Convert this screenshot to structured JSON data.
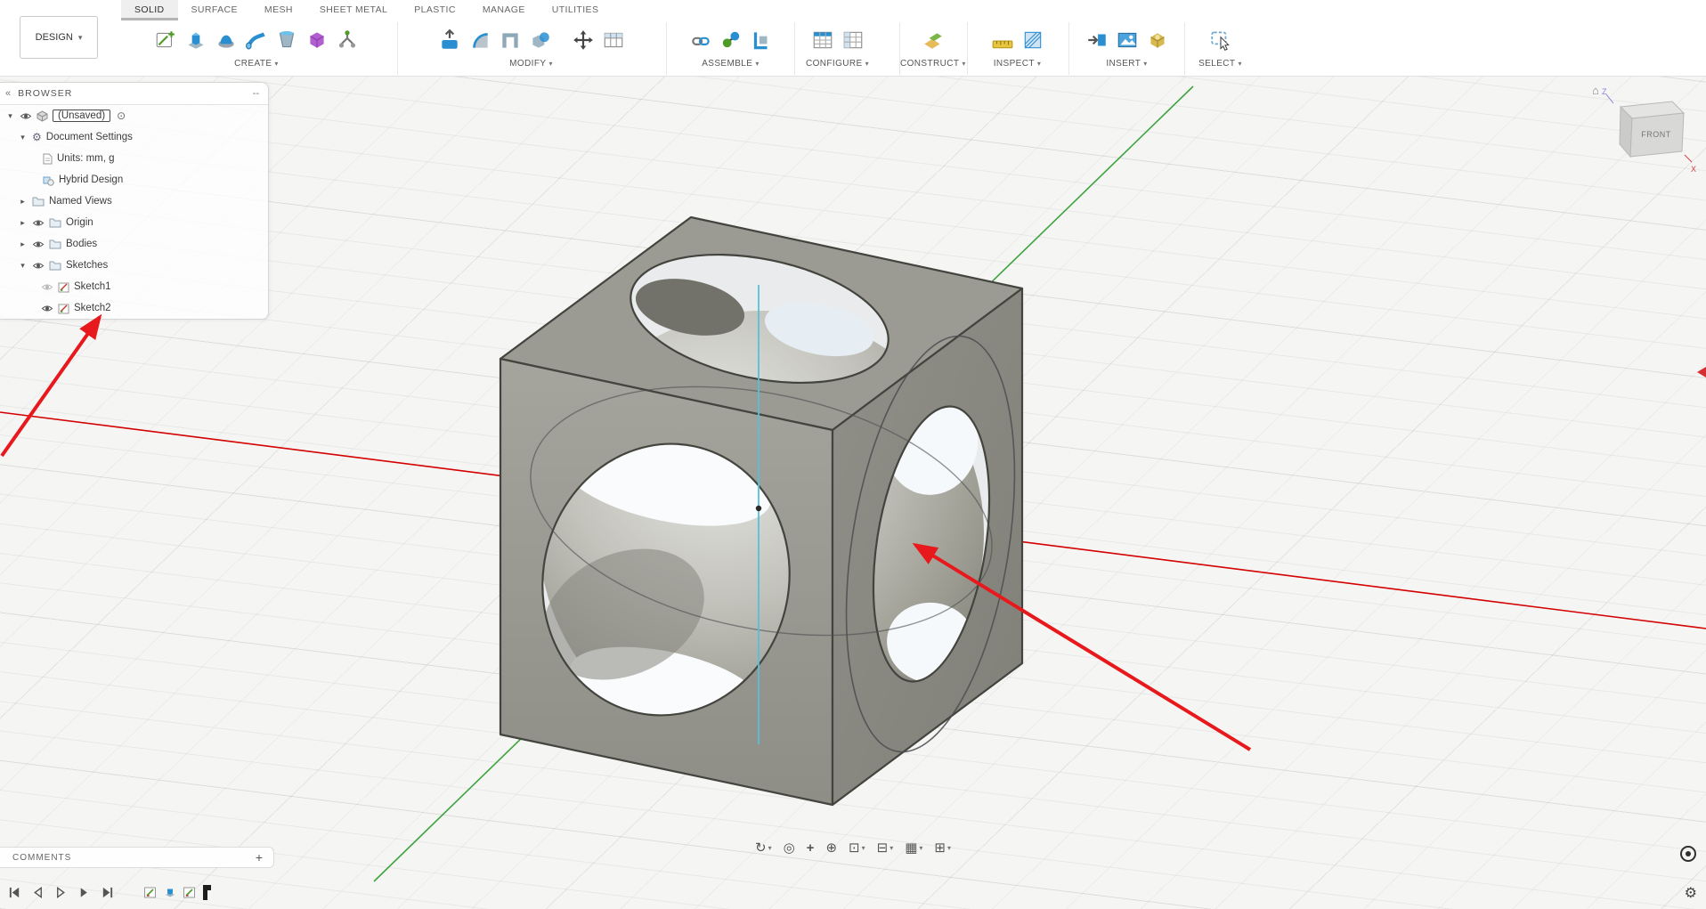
{
  "colors": {
    "annotation_red": "#e8191c",
    "axis_red": "#d40000",
    "axis_green": "#3fa33f",
    "sketch_cyan": "#53c2da",
    "toolbar_bg": "#ffffff",
    "canvas_bg": "#f5f5f4",
    "cube_top": "#9b9b93",
    "cube_left": "#9d9d95",
    "cube_right": "#89897f"
  },
  "header": {
    "design_button": "DESIGN",
    "tabs": [
      "SOLID",
      "SURFACE",
      "MESH",
      "SHEET METAL",
      "PLASTIC",
      "MANAGE",
      "UTILITIES"
    ],
    "active_tab": "SOLID",
    "groups": [
      {
        "label": "CREATE"
      },
      {
        "label": "MODIFY"
      },
      {
        "label": "ASSEMBLE"
      },
      {
        "label": "CONFIGURE"
      },
      {
        "label": "CONSTRUCT"
      },
      {
        "label": "INSPECT"
      },
      {
        "label": "INSERT"
      },
      {
        "label": "SELECT"
      }
    ]
  },
  "browser": {
    "title": "BROWSER",
    "collapse_icon": "«",
    "handle": "--",
    "items": [
      {
        "label": "(Unsaved)"
      },
      {
        "label": "Document Settings"
      },
      {
        "label": "Units: mm, g"
      },
      {
        "label": "Hybrid Design"
      },
      {
        "label": "Named Views"
      },
      {
        "label": "Origin"
      },
      {
        "label": "Bodies"
      },
      {
        "label": "Sketches"
      },
      {
        "label": "Sketch1"
      },
      {
        "label": "Sketch2"
      }
    ]
  },
  "comments": {
    "title": "COMMENTS",
    "add": "+"
  },
  "viewcube": {
    "front": "FRONT",
    "z": "Z",
    "x": "X",
    "home": "⌂"
  },
  "icons": {
    "caret_down": "▾",
    "caret_right": "▸",
    "record": "⊙",
    "gear": "⚙",
    "orbit": "↻",
    "look_at": "◎",
    "pan": "+",
    "zoom": "⊕",
    "window_zoom": "⊡",
    "display": "⊟",
    "grid": "▦",
    "viewports": "⊞"
  }
}
